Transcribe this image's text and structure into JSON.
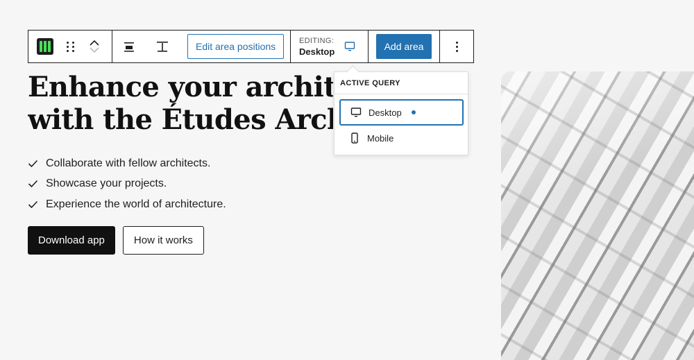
{
  "toolbar": {
    "edit_area_positions": "Edit area positions",
    "editing_label": "EDITING:",
    "editing_value": "Desktop",
    "add_area": "Add area",
    "block_icon_color": "#4ade5a",
    "accent": "#2271b1"
  },
  "dropdown": {
    "heading": "ACTIVE QUERY",
    "items": [
      {
        "label": "Desktop",
        "icon": "desktop-icon",
        "active": true
      },
      {
        "label": "Mobile",
        "icon": "mobile-icon",
        "active": false
      }
    ]
  },
  "hero": {
    "headline_line1": "Enhance your architectural",
    "headline_line2": "with the Études Architect",
    "bullets": [
      "Collaborate with fellow architects.",
      "Showcase your projects.",
      "Experience the world of architecture."
    ],
    "primary_button": "Download app",
    "secondary_button": "How it works"
  }
}
